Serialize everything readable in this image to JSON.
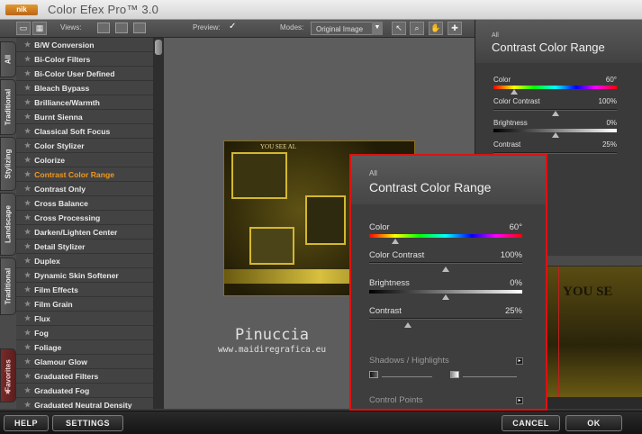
{
  "app": {
    "logo": "nik",
    "title": "Color Efex Pro™ 3.0"
  },
  "toolbar": {
    "views_label": "Views:",
    "preview_label": "Preview:",
    "preview_check": "✓",
    "modes_label": "Modes:",
    "mode_value": "Original Image"
  },
  "tabs": [
    "All",
    "Traditional",
    "Stylizing",
    "Landscape",
    "Traditional",
    "Favorites"
  ],
  "filters": [
    "B/W Conversion",
    "Bi-Color Filters",
    "Bi-Color User Defined",
    "Bleach Bypass",
    "Brilliance/Warmth",
    "Burnt Sienna",
    "Classical Soft Focus",
    "Color Stylizer",
    "Colorize",
    "Contrast Color Range",
    "Contrast Only",
    "Cross Balance",
    "Cross Processing",
    "Darken/Lighten Center",
    "Detail Stylizer",
    "Duplex",
    "Dynamic Skin Softener",
    "Film Effects",
    "Film Grain",
    "Flux",
    "Fog",
    "Foliage",
    "Glamour Glow",
    "Graduated Filters",
    "Graduated Fog",
    "Graduated Neutral Density"
  ],
  "active_filter": "Contrast Color Range",
  "image": {
    "text": "YOU SEE AL"
  },
  "watermark": {
    "name": "Pinuccia",
    "url": "www.maidiregrafica.eu"
  },
  "panel": {
    "all_label": "All",
    "title": "Contrast Color Range",
    "controls": [
      {
        "label": "Color",
        "value": "60°",
        "level": 0.17
      },
      {
        "label": "Color Contrast",
        "value": "100%",
        "level": 0.5
      },
      {
        "label": "Brightness",
        "value": "0%",
        "level": 0.5
      },
      {
        "label": "Contrast",
        "value": "25%",
        "level": 0.25
      }
    ],
    "shadows_label": "Shadows / Highlights",
    "control_points_label": "Control Points"
  },
  "preview": {
    "text": "YOU SE"
  },
  "buttons": {
    "help": "HELP",
    "settings": "SETTINGS",
    "cancel": "CANCEL",
    "ok": "OK"
  },
  "colors": {
    "accent_orange": "#f39a1c",
    "highlight_red": "#e01010"
  }
}
